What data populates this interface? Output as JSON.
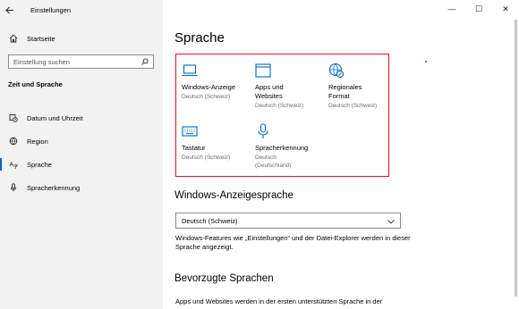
{
  "window": {
    "title": "Einstellungen",
    "controls": {
      "minimize": "—",
      "maximize": "☐",
      "close": "✕"
    }
  },
  "sidebar": {
    "home_label": "Startseite",
    "search_placeholder": "Einstellung suchen",
    "section_title": "Zeit und Sprache",
    "items": [
      {
        "label": "Datum und Uhrzeit",
        "icon": "calendar-clock-icon"
      },
      {
        "label": "Region",
        "icon": "globe-pin-icon"
      },
      {
        "label": "Sprache",
        "icon": "language-icon",
        "active": true
      },
      {
        "label": "Spracherkennung",
        "icon": "microphone-icon"
      }
    ]
  },
  "main": {
    "title": "Sprache",
    "tiles": [
      {
        "title": "Windows-Anzeige",
        "subtitle": "Deutsch (Schweiz)",
        "icon": "monitor-icon"
      },
      {
        "title": "Apps und Websites",
        "subtitle": "Deutsch (Schweiz)",
        "icon": "window-icon"
      },
      {
        "title": "Regionales Format",
        "subtitle": "Deutsch (Schweiz)",
        "icon": "globe-format-icon"
      },
      {
        "title": "Tastatur",
        "subtitle": "Deutsch (Schweiz)",
        "icon": "keyboard-icon"
      },
      {
        "title": "Spracherkennung",
        "subtitle": "Deutsch (Deutschland)",
        "icon": "microphone-icon"
      }
    ],
    "display_language": {
      "heading": "Windows-Anzeigesprache",
      "selected": "Deutsch (Schweiz)",
      "description": "Windows-Features wie „Einstellungen“ und der Datei-Explorer werden in dieser Sprache angezeigt."
    },
    "preferred": {
      "heading": "Bevorzugte Sprachen",
      "description": "Apps und Websites werden in der ersten unterstützten Sprache in der"
    }
  },
  "colors": {
    "accent": "#0067c0",
    "highlight_border": "#e81123",
    "sidebar_bg": "#f2f2f2"
  }
}
